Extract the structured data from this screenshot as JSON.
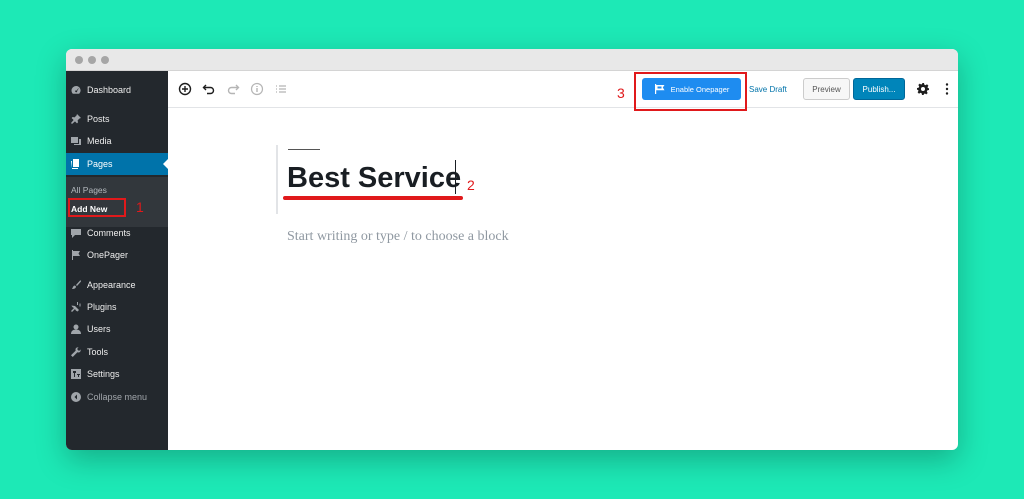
{
  "sidebar": {
    "items": [
      {
        "label": "Dashboard",
        "icon": "dashboard-icon"
      },
      {
        "label": "Posts",
        "icon": "pin-icon"
      },
      {
        "label": "Media",
        "icon": "media-icon"
      },
      {
        "label": "Pages",
        "icon": "pages-icon"
      },
      {
        "label": "Comments",
        "icon": "comment-icon"
      },
      {
        "label": "OnePager",
        "icon": "onepager-icon"
      },
      {
        "label": "Appearance",
        "icon": "brush-icon"
      },
      {
        "label": "Plugins",
        "icon": "plug-icon"
      },
      {
        "label": "Users",
        "icon": "user-icon"
      },
      {
        "label": "Tools",
        "icon": "wrench-icon"
      },
      {
        "label": "Settings",
        "icon": "settings-icon"
      }
    ],
    "submenu": {
      "all_pages": "All Pages",
      "add_new": "Add New"
    },
    "collapse": "Collapse menu"
  },
  "toolbar": {
    "enable_onepager": "Enable Onepager",
    "save_draft": "Save Draft",
    "preview": "Preview",
    "publish": "Publish..."
  },
  "editor": {
    "title": "Best Service",
    "placeholder": "Start writing or type / to choose a block"
  },
  "annotations": {
    "one": "1",
    "two": "2",
    "three": "3"
  },
  "colors": {
    "background": "#1de9b6",
    "sidebar": "#23282d",
    "active": "#0073aa",
    "onepager_button": "#1e8cf0",
    "annotation": "#e0191b"
  }
}
